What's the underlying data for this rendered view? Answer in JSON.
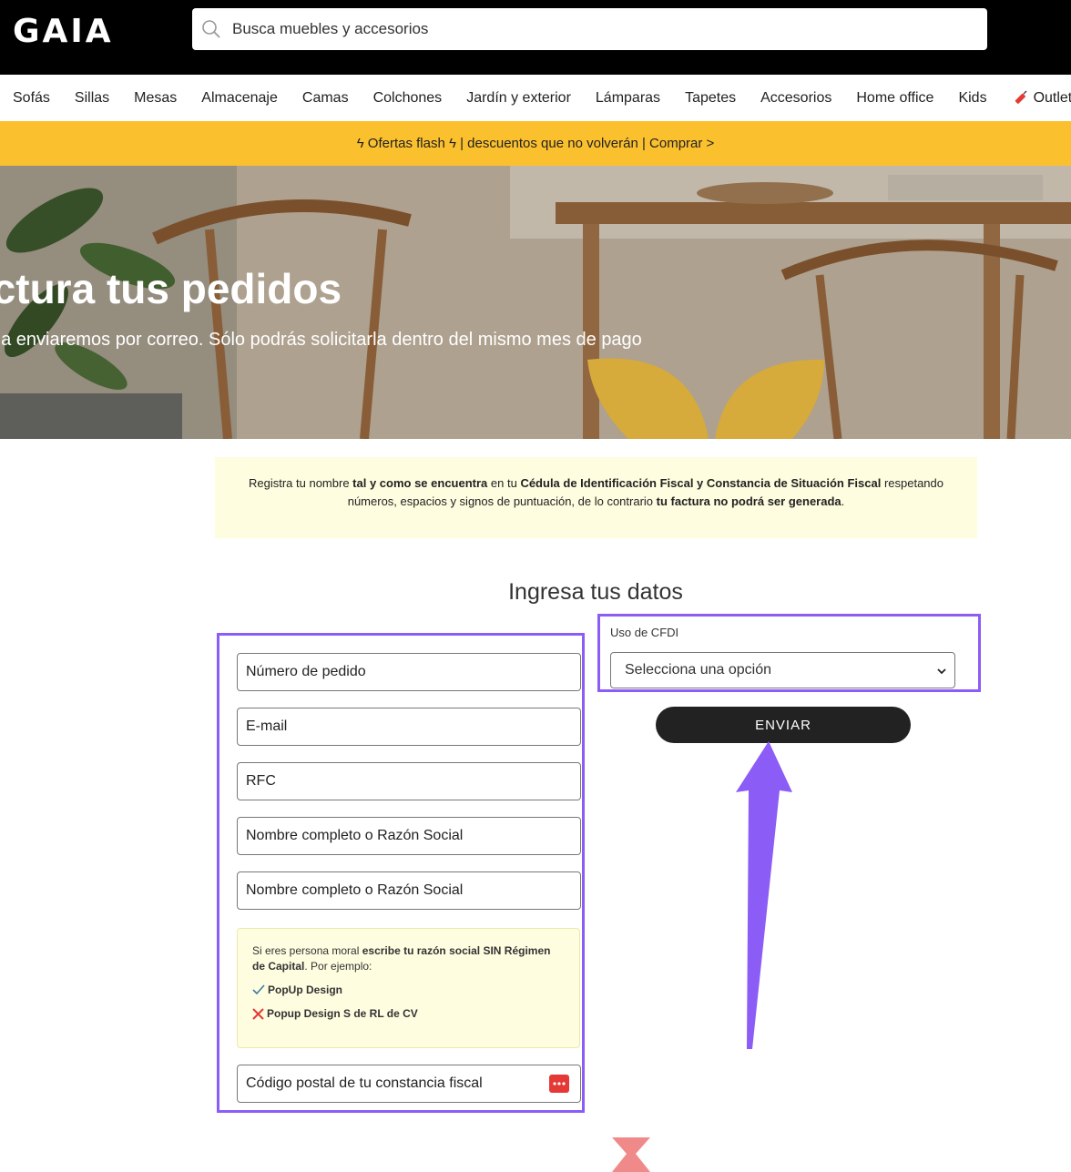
{
  "header": {
    "logo": "GAIA",
    "search_placeholder": "Busca muebles y accesorios"
  },
  "nav": {
    "items": [
      "Sofás",
      "Sillas",
      "Mesas",
      "Almacenaje",
      "Camas",
      "Colchones",
      "Jardín y exterior",
      "Lámparas",
      "Tapetes",
      "Accesorios",
      "Home office",
      "Kids"
    ],
    "outlet": "Outlet ha"
  },
  "promo": {
    "text": "ϟ Ofertas flash ϟ | descuentos que no volverán | Comprar >"
  },
  "hero": {
    "title": "Factura tus pedidos",
    "subtitle": "Te la enviaremos por correo. Sólo podrás solicitarla dentro del mismo mes de pago"
  },
  "notice": {
    "p1": "Registra tu nombre ",
    "b1": "tal y como se encuentra",
    "p2": " en tu ",
    "b2": "Cédula de Identificación Fiscal y Constancia de Situación Fiscal",
    "p3": " respetando números, espacios y signos de puntuación, de lo contrario ",
    "b3": "tu factura no podrá ser generada",
    "p4": "."
  },
  "form": {
    "title": "Ingresa tus datos",
    "order_placeholder": "Número de pedido",
    "email_placeholder": "E-mail",
    "rfc_placeholder": "RFC",
    "name_placeholder": "Nombre completo o Razón Social",
    "name_confirm_placeholder": "Nombre completo o Razón Social",
    "postal_placeholder": "Código postal de tu constancia fiscal",
    "hint": {
      "t1": "Si eres persona moral ",
      "b1": "escribe tu razón social SIN Régimen de Capital",
      "t2": ". Por ejemplo:",
      "good": "PopUp Design",
      "bad": "Popup Design S de RL de CV"
    },
    "cfdi_label": "Uso de CFDI",
    "cfdi_value": "Selecciona una opción",
    "submit": "ENVIAR"
  },
  "colors": {
    "highlight": "#8b5cf6",
    "promo": "#fbc02d",
    "notice_bg": "#fefde0"
  }
}
